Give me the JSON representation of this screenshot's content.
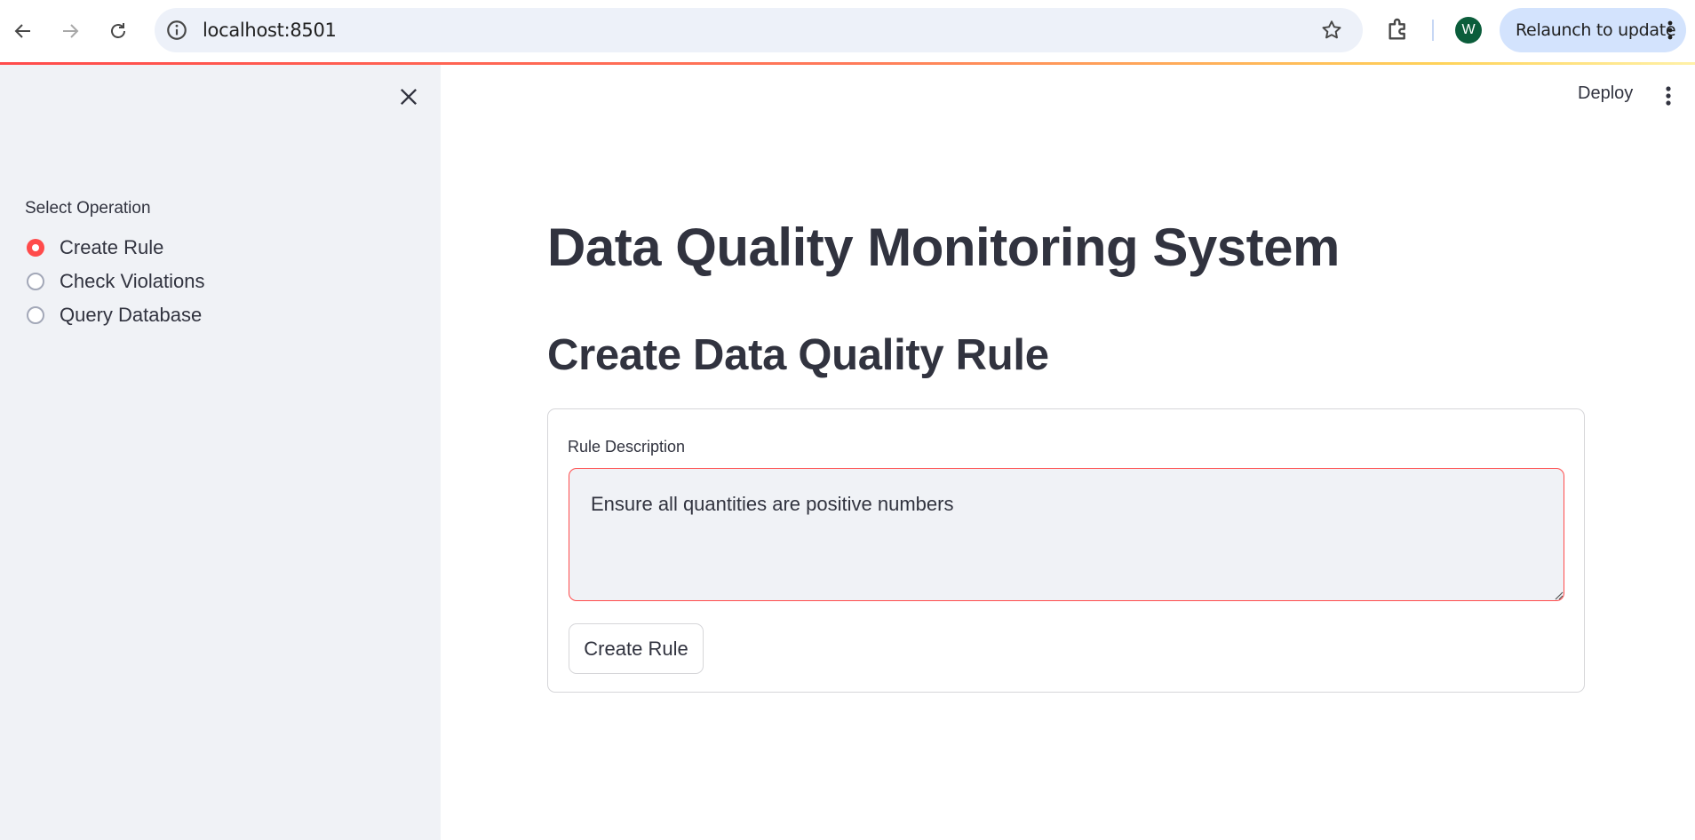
{
  "browser": {
    "url": "localhost:8501",
    "profile_initial": "W",
    "relaunch_label": "Relaunch to update",
    "icons": [
      "back-icon",
      "forward-icon",
      "reload-icon",
      "info-icon",
      "star-icon",
      "extensions-icon",
      "more-vert-icon"
    ]
  },
  "app": {
    "deploy_label": "Deploy",
    "accent_color": "#ff4b4b"
  },
  "sidebar": {
    "radio_label": "Select Operation",
    "options": [
      "Create Rule",
      "Check Violations",
      "Query Database"
    ],
    "selected": "Create Rule"
  },
  "main": {
    "title": "Data Quality Monitoring System",
    "subheader": "Create Data Quality Rule",
    "form": {
      "field_label": "Rule Description",
      "field_value": "Ensure all quantities are positive numbers",
      "submit_label": "Create Rule"
    }
  }
}
